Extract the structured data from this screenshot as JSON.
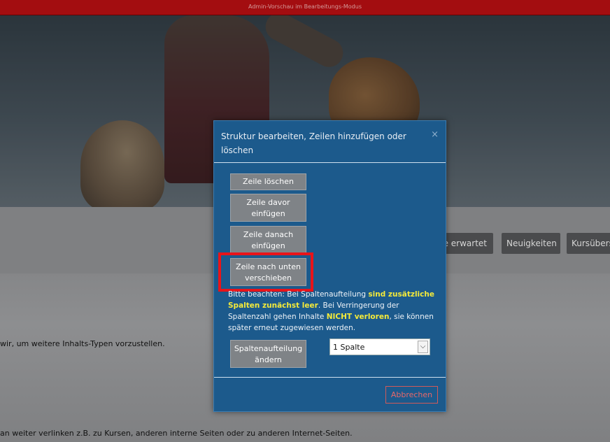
{
  "admin_bar": {
    "text": "Admin-Vorschau im Bearbeitungs-Modus"
  },
  "nav": [
    {
      "label": "sie erwartet"
    },
    {
      "label": "Neuigkeiten"
    },
    {
      "label": "Kursübers"
    }
  ],
  "content": {
    "line1": "wir, um weitere Inhalts-Typen vorzustellen.",
    "line2": "an weiter verlinken z.B. zu Kursen, anderen interne Seiten oder zu anderen Internet-Seiten."
  },
  "modal": {
    "title": "Struktur bearbeiten, Zeilen hinzufügen oder löschen",
    "close": "×",
    "buttons": {
      "delete_row": "Zeile löschen",
      "insert_before": "Zeile davor einfügen",
      "insert_after": "Zeile danach einfügen",
      "move_down": "Zeile nach unten verschieben",
      "change_columns": "Spaltenaufteilung ändern"
    },
    "notice": {
      "part1": "Bitte beachten: Bei Spaltenaufteilung ",
      "hl1": "sind zusätzliche Spalten zunächst leer",
      "part2": ". Bei Verringerung der Spaltenzahl gehen Inhalte ",
      "hl2": "NICHT verloren",
      "part3": ", sie können später erneut zugewiesen werden."
    },
    "select": {
      "value": "1 Spalte"
    },
    "cancel": "Abbrechen"
  },
  "colors": {
    "admin_bar": "#a30d10",
    "modal_bg": "#1c5a8c",
    "highlight": "#e8141a",
    "notice_highlight": "#f4ea3a"
  }
}
